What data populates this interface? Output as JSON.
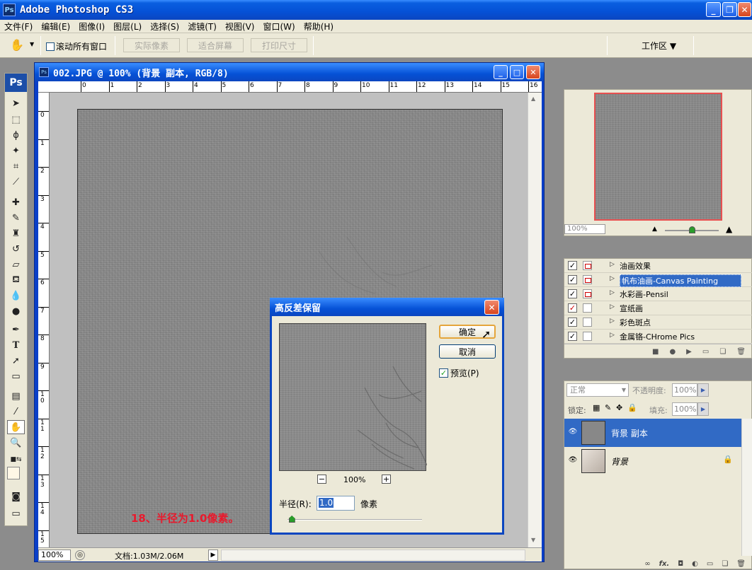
{
  "app": {
    "title": "Adobe Photoshop CS3",
    "icon_text": "Ps"
  },
  "menu": [
    "文件(F)",
    "编辑(E)",
    "图像(I)",
    "图层(L)",
    "选择(S)",
    "滤镜(T)",
    "视图(V)",
    "窗口(W)",
    "帮助(H)"
  ],
  "options": {
    "scroll_all_windows": "滚动所有窗口",
    "actual_pixels": "实际像素",
    "fit_screen": "适合屏幕",
    "print_size": "打印尺寸",
    "workspace": "工作区 ▼"
  },
  "toolbox": {
    "logo": "Ps"
  },
  "document": {
    "title": "002.JPG @ 100% (背景 副本, RGB/8)",
    "ruler_h": [
      "0",
      "1",
      "2",
      "3",
      "4",
      "5",
      "6",
      "7",
      "8",
      "9",
      "10",
      "11",
      "12",
      "13",
      "14",
      "15",
      "16"
    ],
    "ruler_v": [
      "0",
      "1",
      "2",
      "3",
      "4",
      "5",
      "6",
      "7",
      "8",
      "9",
      "1\n0",
      "1\n1",
      "1\n2",
      "1\n3",
      "1\n4",
      "1\n5"
    ],
    "zoom": "100%",
    "doc_size": "文档:1.03M/2.06M"
  },
  "caption": "18、半径为1.0像素。",
  "dialog": {
    "title": "高反差保留",
    "ok": "确定",
    "cancel": "取消",
    "preview_label": "预览(P)",
    "preview_checked": "✓",
    "zoom": "100%",
    "zoom_out": "−",
    "zoom_in": "+",
    "radius_label": "半径(R):",
    "radius_value": "1.0",
    "unit": "像素",
    "radius_slider_fraction": 0.03
  },
  "navigator": {
    "zoom": "100%"
  },
  "actions": [
    {
      "label": "油画效果",
      "checked": "✓",
      "modal": true,
      "selected": false
    },
    {
      "label": "帆布油画-Canvas Painting",
      "checked": "✓",
      "modal": true,
      "selected": true
    },
    {
      "label": "水彩画-Pensil",
      "checked": "✓",
      "modal": true,
      "selected": false
    },
    {
      "label": "宣纸画",
      "checked": "✓",
      "modal": false,
      "selected": false
    },
    {
      "label": "彩色斑点",
      "checked": "✓",
      "modal": false,
      "selected": false
    },
    {
      "label": "金属铬-CHrome Pics",
      "checked": "✓",
      "modal": false,
      "selected": false
    }
  ],
  "layers": {
    "blend_mode": "正常",
    "opacity_label": "不透明度:",
    "opacity": "100%",
    "lock_label": "锁定:",
    "fill_label": "填充:",
    "fill": "100%",
    "items": [
      {
        "name": "背景 副本",
        "selected": true
      },
      {
        "name": "背景",
        "selected": false
      }
    ],
    "footer": "fx."
  }
}
